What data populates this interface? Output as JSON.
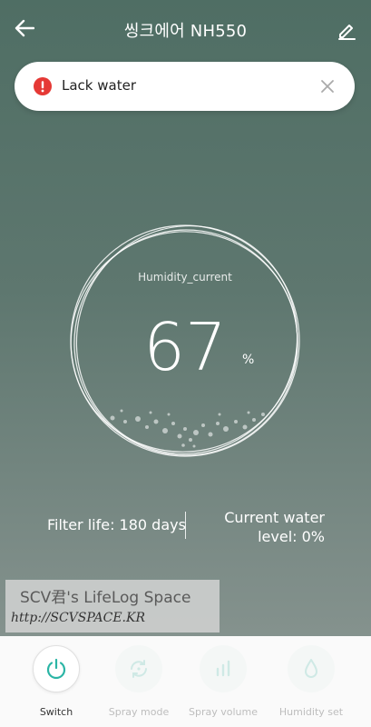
{
  "header": {
    "title": "씽크에어 NH550",
    "back_icon": "arrow-left-icon",
    "edit_icon": "pencil-icon"
  },
  "alert": {
    "message": "Lack water",
    "icon": "error-icon",
    "icon_color": "#e53935",
    "close_icon": "close-icon"
  },
  "gauge": {
    "label": "Humidity_current",
    "value": "67",
    "unit": "%"
  },
  "stats": {
    "filter_life": "Filter life: 180 days",
    "water_level_line1": "Current water",
    "water_level_line2": "level: 0%"
  },
  "watermark": {
    "title": "SCV君's LifeLog Space",
    "url": "http://SCVSPACE.KR"
  },
  "bottom_nav": {
    "items": [
      {
        "label": "Switch",
        "icon": "power-icon",
        "active": true
      },
      {
        "label": "Spray mode",
        "icon": "cycle-icon",
        "active": false
      },
      {
        "label": "Spray volume",
        "icon": "bars-icon",
        "active": false
      },
      {
        "label": "Humidity set",
        "icon": "water-drop-icon",
        "active": false
      }
    ],
    "accent_color": "#2bb5a5",
    "inactive_color": "#cfe9e5"
  }
}
